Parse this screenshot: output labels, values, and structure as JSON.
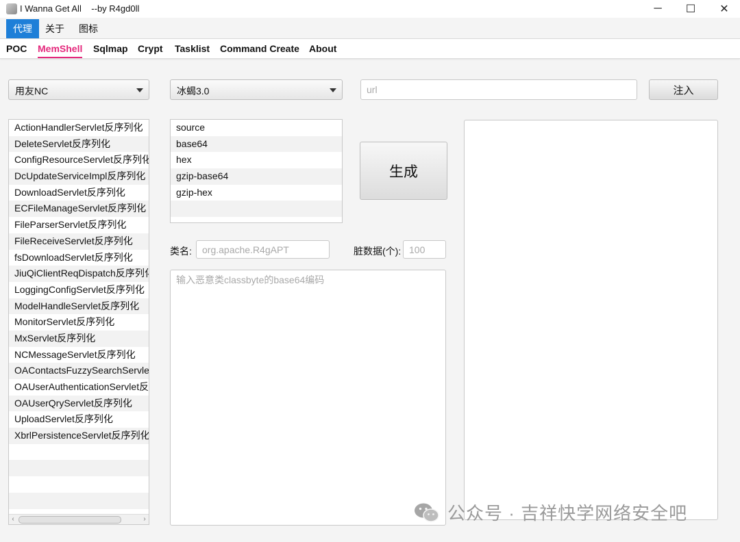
{
  "window": {
    "title": "I Wanna Get All    --by R4gd0ll",
    "minimize": "─",
    "maximize": "☐",
    "close": "✕"
  },
  "menu": {
    "items": [
      "代理",
      "关于",
      "图标"
    ]
  },
  "tabs": [
    "POC",
    "MemShell",
    "Sqlmap",
    "Crypt",
    "Tasklist",
    "Command Create",
    "About"
  ],
  "active_tab": "MemShell",
  "controls": {
    "target_select": "用友NC",
    "tool_select": "冰蝎3.0",
    "url_placeholder": "url",
    "inject_label": "注入",
    "generate_label": "生成",
    "classname_label": "类名:",
    "classname_placeholder": "org.apache.R4gAPT",
    "dirty_label": "脏数据(个):",
    "dirty_placeholder": "100",
    "classbyte_placeholder": "输入恶意类classbyte的base64编码"
  },
  "vuln_list": [
    "ActionHandlerServlet反序列化",
    "DeleteServlet反序列化",
    "ConfigResourceServlet反序列化",
    "DcUpdateServiceImpl反序列化",
    "DownloadServlet反序列化",
    "ECFileManageServlet反序列化",
    "FileParserServlet反序列化",
    "FileReceiveServlet反序列化",
    "fsDownloadServlet反序列化",
    "JiuQiClientReqDispatch反序列化",
    "LoggingConfigServlet反序列化",
    "ModelHandleServlet反序列化",
    "MonitorServlet反序列化",
    "MxServlet反序列化",
    "NCMessageServlet反序列化",
    "OAContactsFuzzySearchServlet反序列化",
    "OAUserAuthenticationServlet反序列化",
    "OAUserQryServlet反序列化",
    "UploadServlet反序列化",
    "XbrlPersistenceServlet反序列化"
  ],
  "encoding_list": [
    "source",
    "base64",
    "hex",
    "gzip-base64",
    "gzip-hex"
  ],
  "watermark": "公众号 · 吉祥快学网络安全吧"
}
